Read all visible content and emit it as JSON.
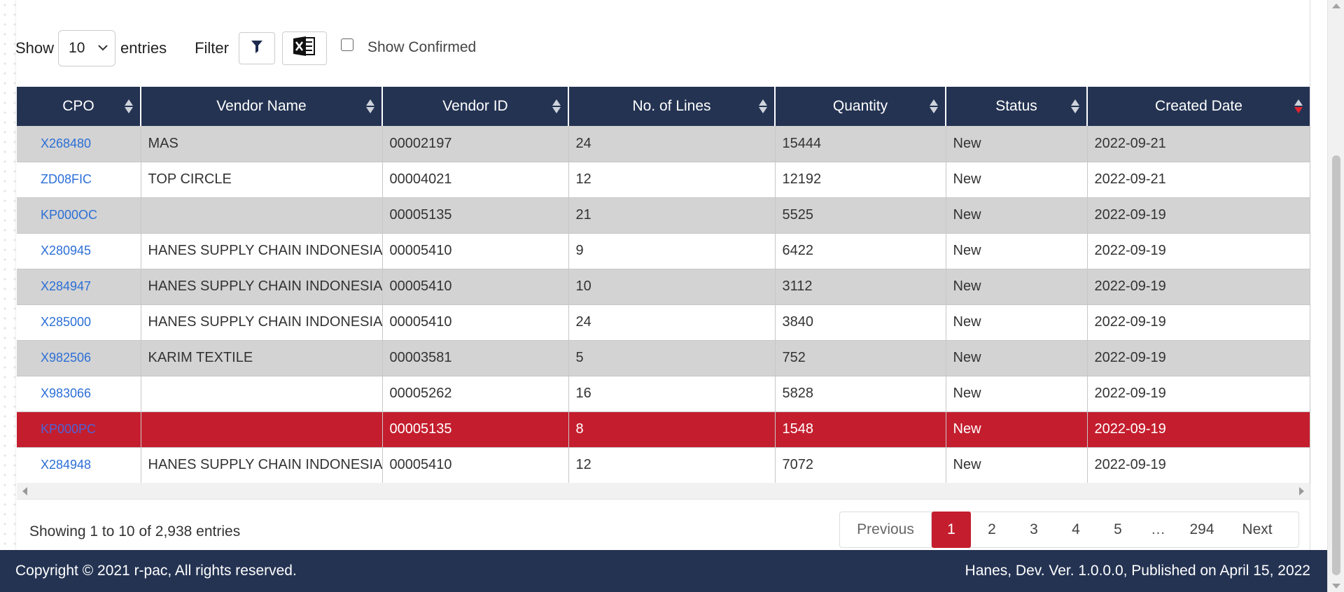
{
  "toolbar": {
    "show_label": "Show",
    "page_size": "10",
    "entries_label": "entries",
    "filter_label": "Filter",
    "show_confirmed_label": "Show Confirmed"
  },
  "table": {
    "columns": [
      "CPO",
      "Vendor Name",
      "Vendor ID",
      "No. of Lines",
      "Quantity",
      "Status",
      "Created Date"
    ],
    "rows": [
      {
        "cpo": "X268480",
        "vendor_name": "MAS",
        "vendor_id": "00002197",
        "lines": "24",
        "quantity": "15444",
        "status": "New",
        "created": "2022-09-21"
      },
      {
        "cpo": "ZD08FIC",
        "vendor_name": "TOP CIRCLE",
        "vendor_id": "00004021",
        "lines": "12",
        "quantity": "12192",
        "status": "New",
        "created": "2022-09-21"
      },
      {
        "cpo": "KP000OC",
        "vendor_name": "",
        "vendor_id": "00005135",
        "lines": "21",
        "quantity": "5525",
        "status": "New",
        "created": "2022-09-19"
      },
      {
        "cpo": "X280945",
        "vendor_name": "HANES SUPPLY CHAIN INDONESIA",
        "vendor_id": "00005410",
        "lines": "9",
        "quantity": "6422",
        "status": "New",
        "created": "2022-09-19"
      },
      {
        "cpo": "X284947",
        "vendor_name": "HANES SUPPLY CHAIN INDONESIA",
        "vendor_id": "00005410",
        "lines": "10",
        "quantity": "3112",
        "status": "New",
        "created": "2022-09-19"
      },
      {
        "cpo": "X285000",
        "vendor_name": "HANES SUPPLY CHAIN INDONESIA",
        "vendor_id": "00005410",
        "lines": "24",
        "quantity": "3840",
        "status": "New",
        "created": "2022-09-19"
      },
      {
        "cpo": "X982506",
        "vendor_name": "KARIM TEXTILE",
        "vendor_id": "00003581",
        "lines": "5",
        "quantity": "752",
        "status": "New",
        "created": "2022-09-19"
      },
      {
        "cpo": "X983066",
        "vendor_name": "",
        "vendor_id": "00005262",
        "lines": "16",
        "quantity": "5828",
        "status": "New",
        "created": "2022-09-19"
      },
      {
        "cpo": "KP000PC",
        "vendor_name": "",
        "vendor_id": "00005135",
        "lines": "8",
        "quantity": "1548",
        "status": "New",
        "created": "2022-09-19"
      },
      {
        "cpo": "X284948",
        "vendor_name": "HANES SUPPLY CHAIN INDONESIA",
        "vendor_id": "00005410",
        "lines": "12",
        "quantity": "7072",
        "status": "New",
        "created": "2022-09-19"
      }
    ]
  },
  "info_text": "Showing 1 to 10 of 2,938 entries",
  "pagination": {
    "previous": "Previous",
    "pages": [
      "1",
      "2",
      "3",
      "4",
      "5"
    ],
    "ellipsis": "…",
    "last": "294",
    "next": "Next"
  },
  "footer": {
    "left": "Copyright © 2021 r-pac, All rights reserved.",
    "right": "Hanes, Dev. Ver. 1.0.0.0, Published on April 15, 2022"
  },
  "colors": {
    "header_bg": "#243352",
    "selected_row": "#c41e2e",
    "alt_row": "#d3d3d3",
    "link": "#2c6fd6"
  },
  "icons": [
    "funnel-icon",
    "excel-icon",
    "sort-icon",
    "chevron-down-icon"
  ]
}
